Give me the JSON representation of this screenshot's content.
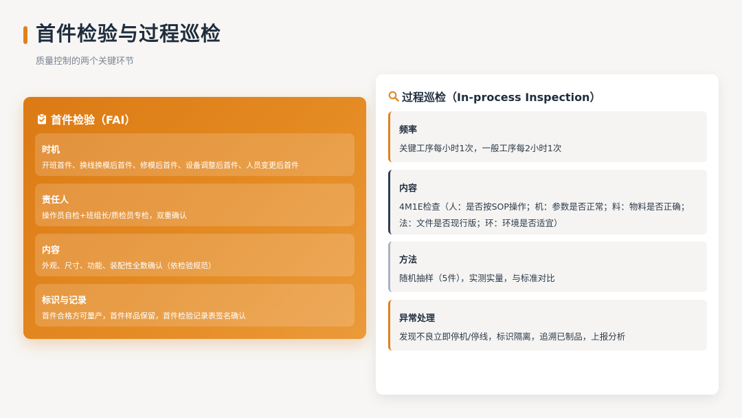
{
  "header": {
    "title": "首件检验与过程巡检",
    "subtitle": "质量控制的两个关键环节"
  },
  "fai": {
    "icon": "clipboard-check-icon",
    "title": "首件检验（FAI）",
    "items": [
      {
        "title": "时机",
        "text": "开班首件、换线换模后首件、修模后首件、设备调整后首件、人员变更后首件"
      },
      {
        "title": "责任人",
        "text": "操作员自检+班组长/质检员专检，双重确认"
      },
      {
        "title": "内容",
        "text": "外观、尺寸、功能、装配性全数确认（依检验规范）"
      },
      {
        "title": "标识与记录",
        "text": "首件合格方可量产，首件样品保留，首件检验记录表签名确认"
      }
    ]
  },
  "inspection": {
    "icon": "search-icon",
    "title": "过程巡检（In-process Inspection）",
    "items": [
      {
        "title": "频率",
        "lines": [
          "关键工序每小时1次，一般工序每2小时1次"
        ]
      },
      {
        "title": "内容",
        "lines": [
          "4M1E检查（人：是否按SOP操作；机：参数是否正常；料：物料是否正确；",
          "法：文件是否现行版；环：环境是否适宜）"
        ]
      },
      {
        "title": "方法",
        "lines": [
          "随机抽样（5件），实测实量，与标准对比"
        ]
      },
      {
        "title": "异常处理",
        "lines": [
          "发现不良立即停机/停线，标识隔离，追溯已制品，上报分析"
        ]
      }
    ]
  },
  "colors": {
    "accent": "#e0821c",
    "dark": "#2f3e50",
    "grey": "#a9b3c0"
  }
}
